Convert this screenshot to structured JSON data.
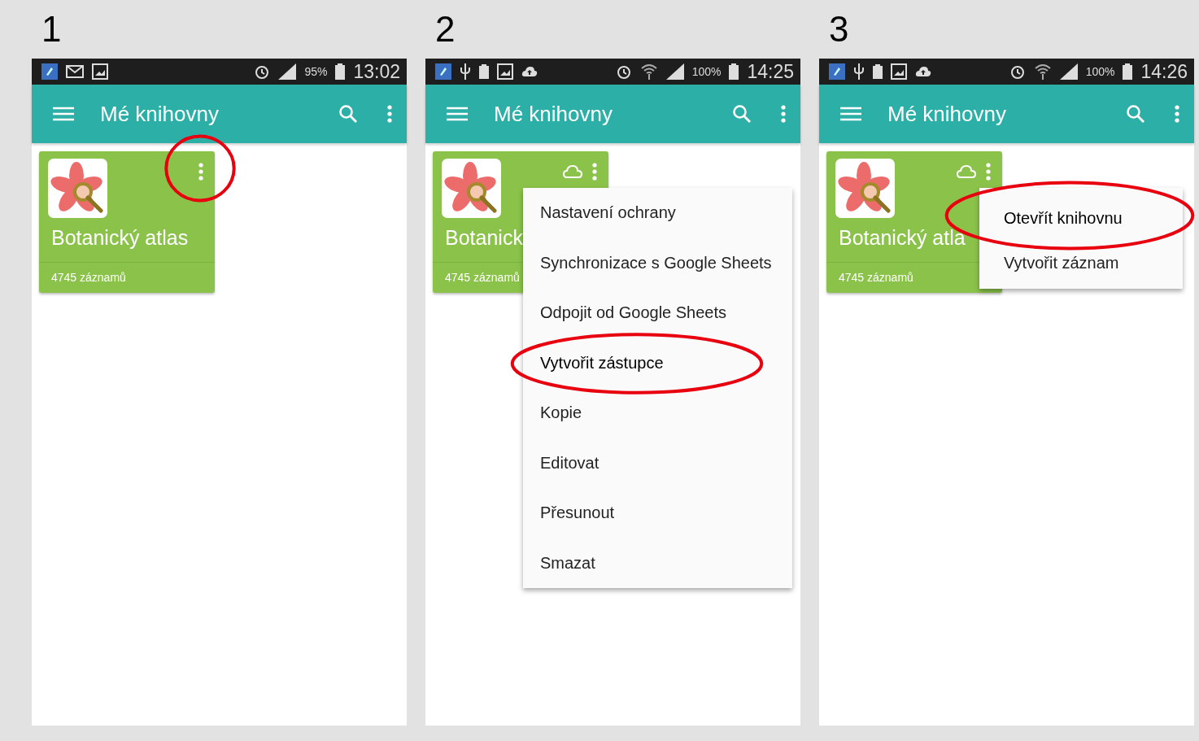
{
  "screens": [
    {
      "step": "1",
      "status_bar": {
        "notifications": [
          {
            "kind": "app"
          },
          {
            "kind": "mail"
          },
          {
            "kind": "image"
          }
        ],
        "wifi": false,
        "battery": "95%",
        "time": "13:02"
      },
      "toolbar": {
        "title": "Mé knihovny"
      },
      "card": {
        "title": "Botanický atlas",
        "count": "4745 záznamů",
        "cloud": false,
        "menu_highlighted": true
      }
    },
    {
      "step": "2",
      "status_bar": {
        "notifications": [
          {
            "kind": "app"
          },
          {
            "kind": "usb"
          },
          {
            "kind": "battery"
          },
          {
            "kind": "image"
          },
          {
            "kind": "upload"
          }
        ],
        "wifi": true,
        "battery": "100%",
        "time": "14:25"
      },
      "toolbar": {
        "title": "Mé knihovny"
      },
      "card": {
        "title": "Botanick",
        "count": "4745 záznamů",
        "cloud": true,
        "menu_highlighted": false
      },
      "menu": [
        {
          "label": "Nastavení ochrany",
          "highlighted": false
        },
        {
          "label": "Synchronizace s Google Sheets",
          "highlighted": false
        },
        {
          "label": "Odpojit od Google Sheets",
          "highlighted": false
        },
        {
          "label": "Vytvořit zástupce",
          "highlighted": true
        },
        {
          "label": "Kopie",
          "highlighted": false
        },
        {
          "label": "Editovat",
          "highlighted": false
        },
        {
          "label": "Přesunout",
          "highlighted": false
        },
        {
          "label": "Smazat",
          "highlighted": false
        }
      ]
    },
    {
      "step": "3",
      "status_bar": {
        "notifications": [
          {
            "kind": "app"
          },
          {
            "kind": "usb"
          },
          {
            "kind": "battery"
          },
          {
            "kind": "image"
          },
          {
            "kind": "upload"
          }
        ],
        "wifi": true,
        "battery": "100%",
        "time": "14:26"
      },
      "toolbar": {
        "title": "Mé knihovny"
      },
      "card": {
        "title": "Botanický atla",
        "count": "4745 záznamů",
        "cloud": true,
        "menu_highlighted": false
      },
      "menu": [
        {
          "label": "Otevřít knihovnu",
          "highlighted": true
        },
        {
          "label": "Vytvořit záznam",
          "highlighted": false
        }
      ]
    }
  ]
}
